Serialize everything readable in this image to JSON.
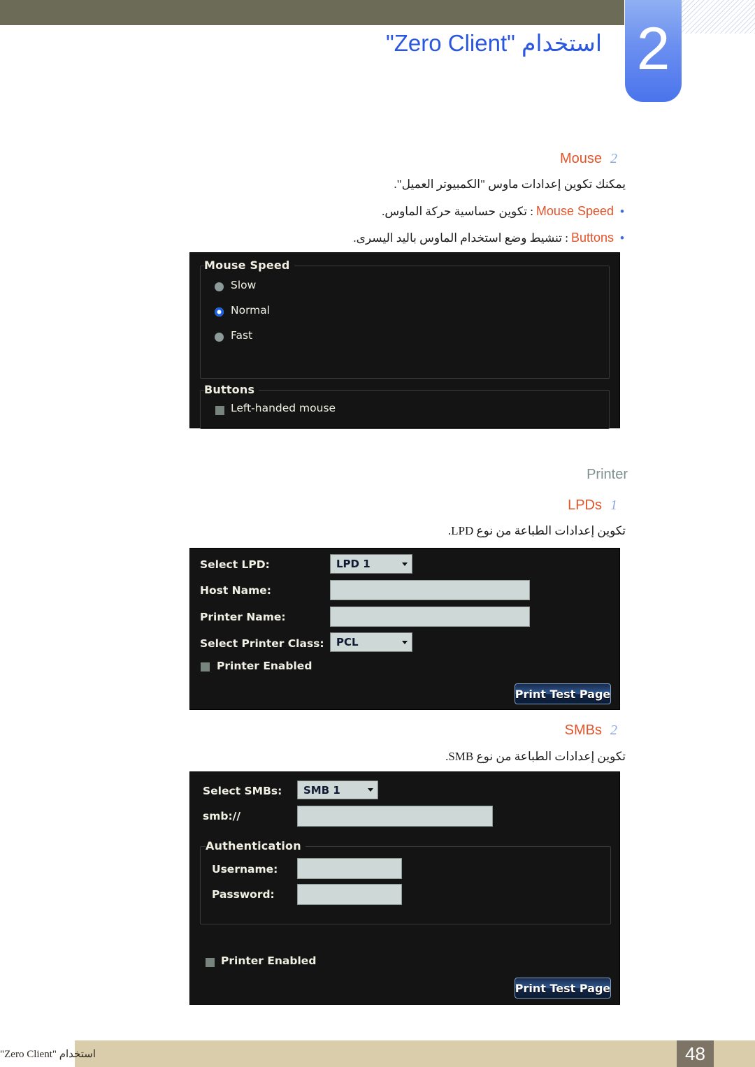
{
  "header": {
    "chapter_number": "2",
    "chapter_title": "استخدام \"Zero Client\""
  },
  "mouse_section": {
    "step_number": "2",
    "step_label": "Mouse",
    "intro": "يمكنك تكوين إعدادات ماوس \"الكمبيوتر العميل\".",
    "bullets": [
      {
        "dot": "•",
        "term": "Mouse Speed",
        "text": ": تكوين حساسية حركة الماوس."
      },
      {
        "dot": "•",
        "term": "Buttons",
        "text": ": تنشيط وضع استخدام الماوس باليد اليسرى."
      }
    ],
    "osd": {
      "group_speed_title": "Mouse Speed",
      "radios": [
        {
          "label": "Slow",
          "selected": false
        },
        {
          "label": "Normal",
          "selected": true
        },
        {
          "label": "Fast",
          "selected": false
        }
      ],
      "group_buttons_title": "Buttons",
      "checkbox_label": "Left-handed mouse",
      "checkbox_checked": false
    }
  },
  "printer_section": {
    "heading": "Printer",
    "lpds": {
      "step_number": "1",
      "step_label": "LPDs",
      "intro": "تكوين إعدادات الطباعة من نوع LPD.",
      "osd": {
        "select_lpd_label": "Select LPD:",
        "select_lpd_value": "LPD 1",
        "host_name_label": "Host Name:",
        "host_name_value": "",
        "printer_name_label": "Printer Name:",
        "printer_name_value": "",
        "printer_class_label": "Select Printer Class:",
        "printer_class_value": "PCL",
        "printer_enabled_label": "Printer Enabled",
        "printer_enabled_checked": false,
        "print_test_page_label": "Print Test Page"
      }
    },
    "smbs": {
      "step_number": "2",
      "step_label": "SMBs",
      "intro": "تكوين إعدادات الطباعة من نوع SMB.",
      "osd": {
        "select_smbs_label": "Select SMBs:",
        "select_smbs_value": "SMB 1",
        "smb_url_label": "smb://",
        "smb_url_value": "",
        "auth_group_title": "Authentication",
        "username_label": "Username:",
        "username_value": "",
        "password_label": "Password:",
        "password_value": "",
        "printer_enabled_label": "Printer Enabled",
        "printer_enabled_checked": false,
        "print_test_page_label": "Print Test Page"
      }
    }
  },
  "footer": {
    "text": "استخدام \"Zero Client\"",
    "page_number": "48"
  },
  "colors": {
    "olive_bar": "#6c6b58",
    "chapter_blue": "#4a74ec",
    "title_blue": "#2b56e0",
    "step_orange": "#e2542a",
    "step_number_blue": "#8aa9e0",
    "section_gray": "#7d8f8f",
    "osd_background": "#141414",
    "footer_bar": "#d9cdab",
    "footer_num_bg": "#7e7465"
  }
}
